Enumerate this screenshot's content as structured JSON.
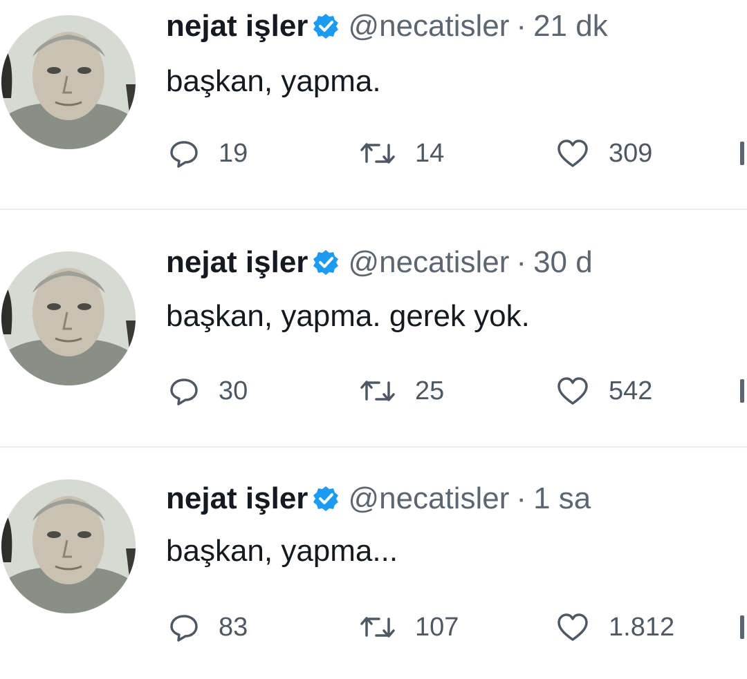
{
  "colors": {
    "verified_badge": "#1d9bf0",
    "text_primary": "#141a1f",
    "text_secondary": "#5b6670",
    "divider": "#e6ecf0"
  },
  "icons": {
    "reply": "speech-bubble-icon",
    "retweet": "retweet-arrows-icon",
    "like": "heart-icon",
    "verified": "verified-badge-icon"
  },
  "tweets": [
    {
      "name": "nejat işler",
      "handle": "@necatisler",
      "separator": "·",
      "time": "21 dk",
      "text": "başkan, yapma.",
      "replies": "19",
      "retweets": "14",
      "likes": "309"
    },
    {
      "name": "nejat işler",
      "handle": "@necatisler",
      "separator": "·",
      "time": "30 d",
      "text": "başkan, yapma. gerek yok.",
      "replies": "30",
      "retweets": "25",
      "likes": "542"
    },
    {
      "name": "nejat işler",
      "handle": "@necatisler",
      "separator": "·",
      "time": "1 sa",
      "text": "başkan, yapma...",
      "replies": "83",
      "retweets": "107",
      "likes": "1.812"
    }
  ]
}
